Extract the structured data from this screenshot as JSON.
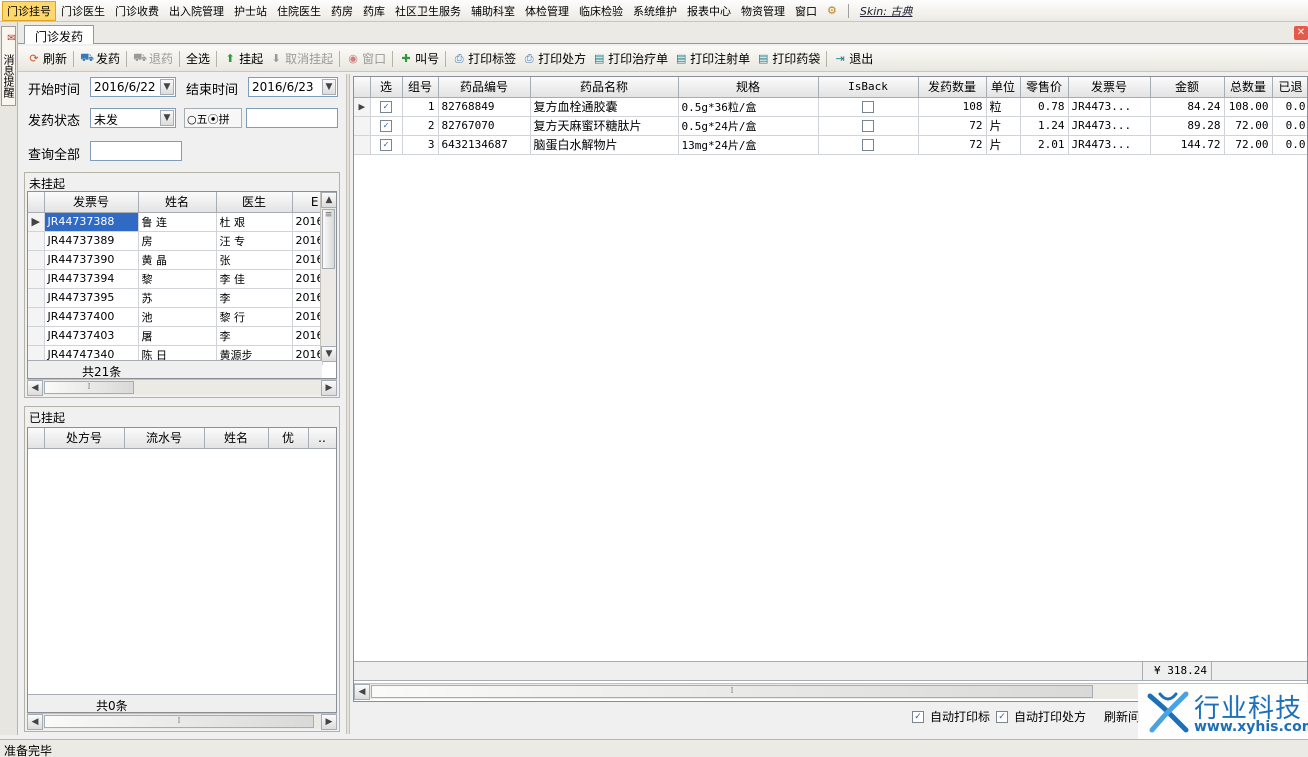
{
  "menu": [
    "门诊挂号",
    "门诊医生",
    "门诊收费",
    "出入院管理",
    "护士站",
    "住院医生",
    "药房",
    "药库",
    "社区卫生服务",
    "辅助科室",
    "体检管理",
    "临床检验",
    "系统维护",
    "报表中心",
    "物资管理",
    "窗口"
  ],
  "skin_label": "Skin: 古典",
  "left_strip_label": "消息提醒",
  "tab_title": "门诊发药",
  "toolbar": {
    "refresh": "刷新",
    "dispense": "发药",
    "return": "退药",
    "select_all": "全选",
    "hang": "挂起",
    "cancel_hang": "取消挂起",
    "window": "窗口",
    "call": "叫号",
    "print_label": "打印标签",
    "print_rx": "打印处方",
    "print_treat": "打印治疗单",
    "print_inject": "打印注射单",
    "print_bag": "打印药袋",
    "exit": "退出"
  },
  "filters": {
    "start_label": "开始时间",
    "start_value": "2016/6/22",
    "end_label": "结束时间",
    "end_value": "2016/6/23",
    "status_label": "发药状态",
    "status_value": "未发",
    "radio_a": "五",
    "radio_b": "拼",
    "query_label": "查询全部"
  },
  "unhung": {
    "title": "未挂起",
    "columns": [
      "发票号",
      "姓名",
      "医生",
      "E"
    ],
    "rows": [
      {
        "invoice": "JR44737388",
        "name": "鲁  连",
        "doctor": "杜  艰",
        "date": "2016"
      },
      {
        "invoice": "JR44737389",
        "name": "房",
        "doctor": "汪  专",
        "date": "2016"
      },
      {
        "invoice": "JR44737390",
        "name": "黄    晶",
        "doctor": "张",
        "date": "2016"
      },
      {
        "invoice": "JR44737394",
        "name": "黎",
        "doctor": "李    佳",
        "date": "2016"
      },
      {
        "invoice": "JR44737395",
        "name": "苏",
        "doctor": "李",
        "date": "2016"
      },
      {
        "invoice": "JR44737400",
        "name": "池",
        "doctor": "黎  行",
        "date": "2016"
      },
      {
        "invoice": "JR44737403",
        "name": "屠",
        "doctor": "李",
        "date": "2016"
      },
      {
        "invoice": "JR44747340",
        "name": "陈    日",
        "doctor": "黄源步",
        "date": "2016"
      }
    ],
    "count": "共21条"
  },
  "hung": {
    "title": "已挂起",
    "columns": [
      "处方号",
      "流水号",
      "姓名",
      "优",
      ".."
    ],
    "count": "共0条"
  },
  "main_grid": {
    "columns": [
      "选",
      "组号",
      "药品编号",
      "药品名称",
      "规格",
      "IsBack",
      "发药数量",
      "单位",
      "零售价",
      "发票号",
      "金额",
      "总数量",
      "已退"
    ],
    "rows": [
      {
        "group": "1",
        "code": "82768849",
        "name": "复方血栓通胶囊",
        "spec": "0.5g*36粒/盒",
        "qty": "108",
        "unit": "粒",
        "price": "0.78",
        "invoice": "JR4473...",
        "amount": "84.24",
        "total": "108.00",
        "returned": "0.0"
      },
      {
        "group": "2",
        "code": "82767070",
        "name": "复方天麻蜜环糖肽片",
        "spec": "0.5g*24片/盒",
        "qty": "72",
        "unit": "片",
        "price": "1.24",
        "invoice": "JR4473...",
        "amount": "89.28",
        "total": "72.00",
        "returned": "0.0"
      },
      {
        "group": "3",
        "code": "6432134687",
        "name": "脑蛋白水解物片",
        "spec": "13mg*24片/盒",
        "qty": "72",
        "unit": "片",
        "price": "2.01",
        "invoice": "JR4473...",
        "amount": "144.72",
        "total": "72.00",
        "returned": "0.0"
      }
    ],
    "sum_amount": "¥ 318.24"
  },
  "options": {
    "auto_print_label": "自动打印标",
    "auto_print_rx": "自动打印处方",
    "refresh_short": "刷新间"
  },
  "logo": {
    "cn": "行业科技",
    "url": "www.xyhis.com"
  },
  "status": "准备完毕",
  "colors": {
    "menu_active": "#ffd86b",
    "selection": "#316ac5",
    "logo_blue": "#1d6fb8"
  }
}
